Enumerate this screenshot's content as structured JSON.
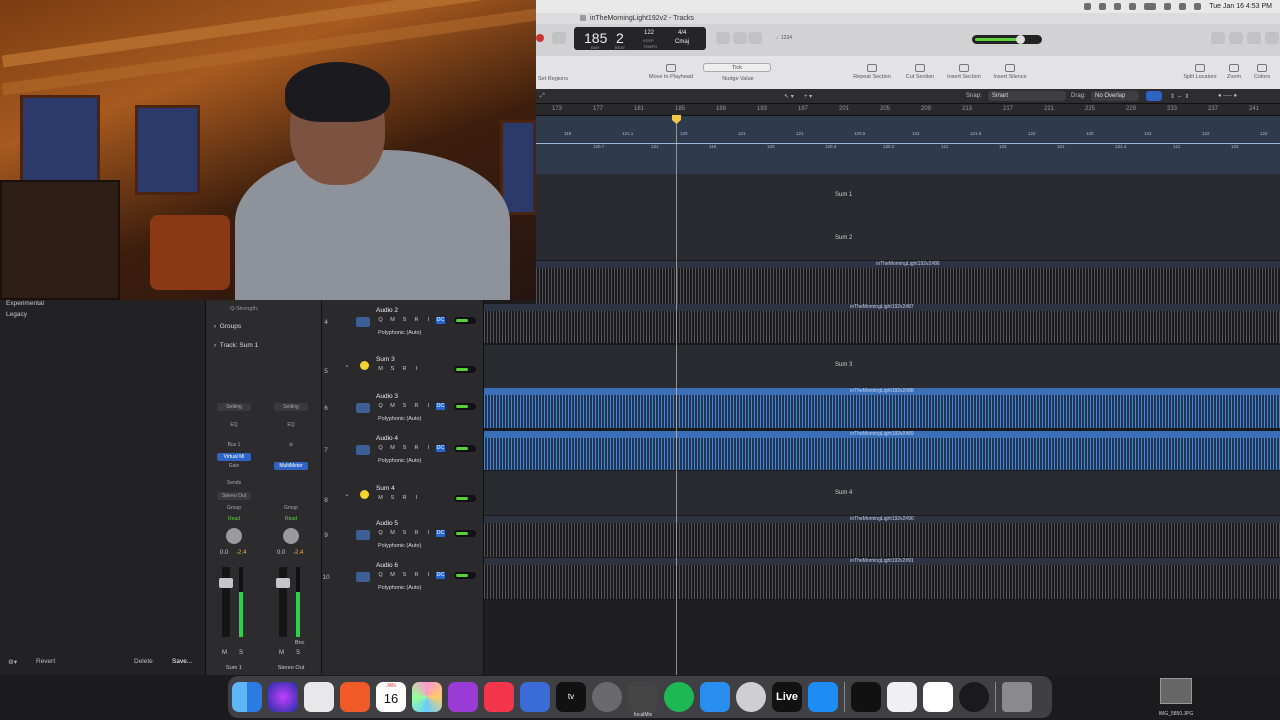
{
  "menubar": {
    "datetime": "Tue Jan 16  4:53 PM"
  },
  "window": {
    "title": "inTheMorningLight192v2 - Tracks"
  },
  "lcd": {
    "bar": "185",
    "beat": "2",
    "bar_label": "BAR",
    "beat_label": "BEAT",
    "tempo": "122",
    "tempo_label": "KEEP",
    "key_label": "TEMPO",
    "signature": "4/4",
    "key": "Cmaj"
  },
  "control": {
    "count_in": "♩1234"
  },
  "toolbar": {
    "tick_label": "Tick",
    "move_to_playhead": "Move to Playhead",
    "nudge_value": "Nudge Value",
    "repeat_section": "Repeat Section",
    "cut_section": "Cut Section",
    "insert_section": "Insert Section",
    "insert_silence": "Insert Silence",
    "split_locators": "Split Locators",
    "zoom": "Zoom",
    "colors": "Colors",
    "set_regions": "Set Regions"
  },
  "tracks_header": {
    "snap_label": "Snap:",
    "snap_value": "Smart",
    "drag_label": "Drag:",
    "drag_value": "No Overlap"
  },
  "ruler": {
    "bars": [
      "173",
      "177",
      "181",
      "185",
      "189",
      "193",
      "197",
      "201",
      "205",
      "209",
      "213",
      "217",
      "221",
      "225",
      "229",
      "233",
      "237",
      "241"
    ]
  },
  "tempo_values": [
    "119",
    "120.7",
    "121.1",
    "121",
    "120",
    "119",
    "121",
    "120",
    "121",
    "120.3",
    "120.6",
    "120.2",
    "122",
    "121",
    "121.6",
    "123",
    "122",
    "121",
    "120",
    "121.4",
    "122",
    "121",
    "122",
    "123",
    "122"
  ],
  "lanes": {
    "sum1": "Sum 1",
    "sum2": "Sum 2",
    "sum3": "Sum 3",
    "sum4": "Sum 4",
    "r1": "inTheMorningLight192v2#86",
    "r2": "inTheMorningLight192v2#87",
    "r3": "inTheMorningLight192v2#88",
    "r4": "inTheMorningLight192v2#89",
    "r5": "inTheMorningLight192v2#90",
    "r6": "inTheMorningLight192v2#91"
  },
  "browser": {
    "items": [
      "Experimental",
      "Legacy"
    ],
    "revert": "Revert",
    "delete": "Delete",
    "save": "Save..."
  },
  "inspector": {
    "q_strength": "Q-Strength:",
    "groups": "Groups",
    "track_label": "Track:",
    "track_value": "Sum 1"
  },
  "strips": [
    {
      "setting": "Setting",
      "eq": "EQ",
      "io": "Bus 1",
      "plugin": "Virtual Mi",
      "plugin2": "Gain",
      "sends": "Sends",
      "out": "Stereo Out",
      "group": "Group",
      "auto": "Read",
      "val1": "0.0",
      "val2": "-2.4",
      "name": "Sum 1"
    },
    {
      "setting": "Setting",
      "eq": "EQ",
      "io": "",
      "plugin": "MultiMeter",
      "plugin2": "",
      "sends": "",
      "out": "",
      "group": "Group",
      "auto": "Read",
      "val1": "0.0",
      "val2": "-2.4",
      "name": "Stereo Out",
      "bnc": "Bnc"
    }
  ],
  "track_headers": [
    {
      "num": "4",
      "name": "Audio 2",
      "poly": "Polyphonic (Auto)"
    },
    {
      "num": "5",
      "name": "Sum 3",
      "poly": ""
    },
    {
      "num": "6",
      "name": "Audio 3",
      "poly": "Polyphonic (Auto)"
    },
    {
      "num": "7",
      "name": "Audio 4",
      "poly": "Polyphonic (Auto)"
    },
    {
      "num": "8",
      "name": "Sum 4",
      "poly": ""
    },
    {
      "num": "9",
      "name": "Audio 5",
      "poly": "Polyphonic (Auto)"
    },
    {
      "num": "10",
      "name": "Audio 6",
      "poly": "Polyphonic (Auto)"
    }
  ],
  "buttons": {
    "q": "Q",
    "m": "M",
    "s": "S",
    "r": "R",
    "i": "I",
    "dc": "DC"
  },
  "dock": {
    "finder": "Finder",
    "calendar_day": "16",
    "calendar_month": "JAN",
    "live": "Live",
    "focalmix": "focalMix"
  },
  "desktop": {
    "file": "IMG_5850.JPG"
  },
  "colors": {
    "accent": "#2f64c4",
    "region_blue": "#4f84c6",
    "volume_green": "#5ad13b",
    "sum_yellow": "#f1d52e"
  }
}
